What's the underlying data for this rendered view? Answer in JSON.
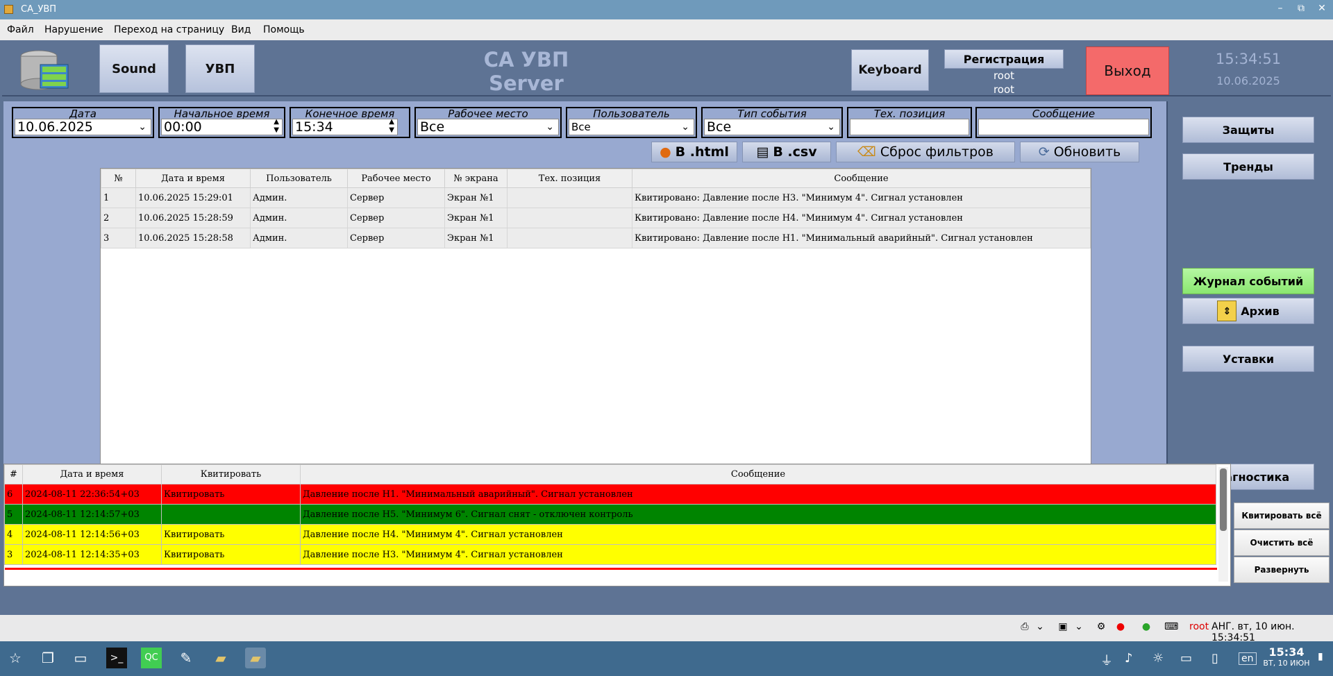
{
  "window": {
    "title": "СА_УВП",
    "min": "–",
    "max": "⧉",
    "close": "✕"
  },
  "menu": [
    "Файл",
    "Нарушение",
    "Переход на страницу",
    "Вид",
    "Помощь"
  ],
  "header": {
    "sound": "Sound",
    "uvp": "УВП",
    "title1": "СА УВП",
    "title2": "Server",
    "keyboard": "Keyboard",
    "registration": "Регистрация",
    "user1": "root",
    "user2": "root",
    "exit": "Выход",
    "time": "15:34:51",
    "date": "10.06.2025"
  },
  "filters": {
    "date": {
      "label": "Дата",
      "value": "10.06.2025"
    },
    "start": {
      "label": "Начальное время",
      "value": "00:00"
    },
    "end": {
      "label": "Конечное время",
      "value": "15:34"
    },
    "workplace": {
      "label": "Рабочее место",
      "value": "Все"
    },
    "user": {
      "label": "Пользователь",
      "value": "Все"
    },
    "event_type": {
      "label": "Тип события",
      "value": "Все"
    },
    "tech_pos": {
      "label": "Тех. позиция",
      "value": ""
    },
    "message": {
      "label": "Сообщение",
      "value": ""
    }
  },
  "actions": {
    "html": "В .html",
    "csv": "В .csv",
    "reset": "Сброс фильтров",
    "refresh": "Обновить"
  },
  "journal": {
    "columns": [
      "№",
      "Дата и время",
      "Пользователь",
      "Рабочее место",
      "№ экрана",
      "Тех. позиция",
      "Сообщение"
    ],
    "rows": [
      [
        "1",
        "10.06.2025 15:29:01",
        "Админ.",
        "Сервер",
        "Экран №1",
        "",
        "Квитировано: Давление после Н3. \"Минимум 4\". Сигнал установлен"
      ],
      [
        "2",
        "10.06.2025 15:28:59",
        "Админ.",
        "Сервер",
        "Экран №1",
        "",
        "Квитировано: Давление после Н4. \"Минимум 4\". Сигнал установлен"
      ],
      [
        "3",
        "10.06.2025 15:28:58",
        "Админ.",
        "Сервер",
        "Экран №1",
        "",
        "Квитировано: Давление после Н1. \"Минимальный аварийный\". Сигнал установлен"
      ]
    ]
  },
  "side": {
    "protection": "Защиты",
    "trends": "Тренды",
    "journal": "Журнал событий",
    "archive": "Архив",
    "setpoints": "Уставки",
    "diagnostics": "Диагностика"
  },
  "alarms": {
    "columns": [
      "#",
      "Дата и время",
      "Квитировать",
      "Сообщение"
    ],
    "rows": [
      {
        "color": "red",
        "cells": [
          "6",
          "2024-08-11 22:36:54+03",
          "Квитировать",
          "Давление после Н1. \"Минимальный аварийный\". Сигнал установлен"
        ]
      },
      {
        "color": "green",
        "cells": [
          "5",
          "2024-08-11 12:14:57+03",
          "",
          "Давление после Н5. \"Минимум 6\". Сигнал снят - отключен контроль"
        ]
      },
      {
        "color": "yellow",
        "cells": [
          "4",
          "2024-08-11 12:14:56+03",
          "Квитировать",
          "Давление после Н4. \"Минимум 4\". Сигнал установлен"
        ]
      },
      {
        "color": "yellow",
        "cells": [
          "3",
          "2024-08-11 12:14:35+03",
          "Квитировать",
          "Давление после Н3. \"Минимум 4\". Сигнал установлен"
        ]
      }
    ],
    "ack_all": "Квитировать всё",
    "clear_all": "Очистить всё",
    "expand": "Развернуть"
  },
  "status": {
    "user": "root",
    "text": "АНГ. вт, 10 июн. 15:34:51"
  },
  "taskbar": {
    "lang": "en",
    "time": "15:34",
    "date": "ВТ, 10 ИЮН"
  },
  "colors": {
    "accent": "#5e7394",
    "alarm_red": "#ff0000",
    "alarm_green": "#008400",
    "alarm_yellow": "#ffff00"
  }
}
